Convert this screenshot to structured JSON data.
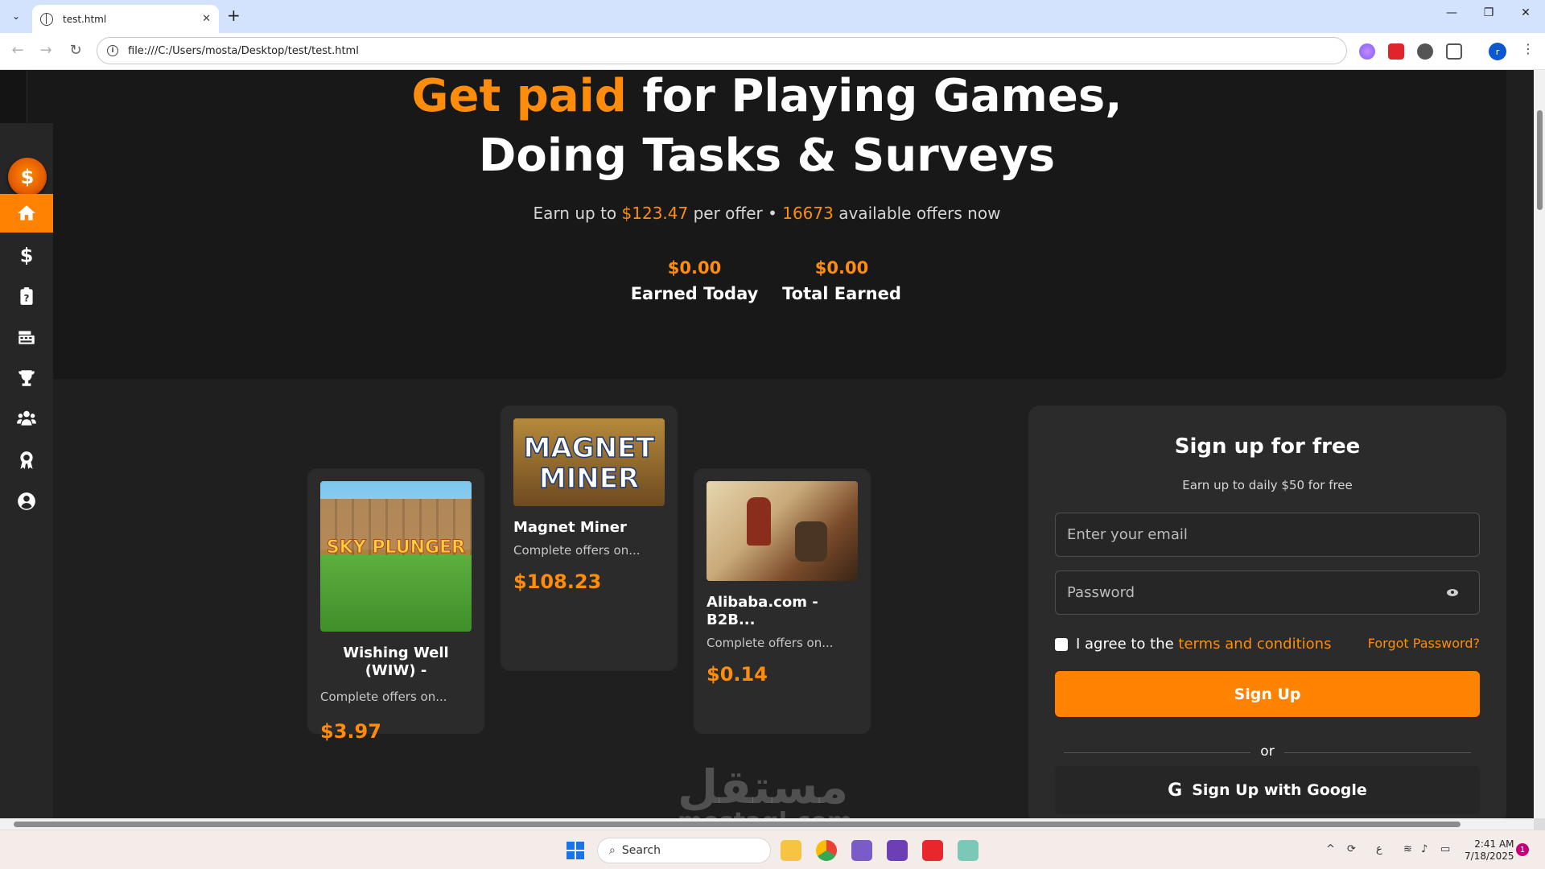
{
  "browser": {
    "tab_title": "test.html",
    "url": "file:///C:/Users/mosta/Desktop/test/test.html",
    "profile_initial": "r"
  },
  "sidebar": {
    "logo_symbol": "$",
    "items": [
      {
        "icon": "home-icon",
        "active": true
      },
      {
        "icon": "dollar-icon",
        "active": false
      },
      {
        "icon": "clipboard-question-icon",
        "active": false
      },
      {
        "icon": "keyboard-icon",
        "active": false
      },
      {
        "icon": "trophy-icon",
        "active": false
      },
      {
        "icon": "users-icon",
        "active": false
      },
      {
        "icon": "award-icon",
        "active": false
      },
      {
        "icon": "user-circle-icon",
        "active": false
      }
    ]
  },
  "hero": {
    "headline_accent": "Get paid",
    "headline_rest": " for Playing Games,",
    "headline_line2": "Doing Tasks & Surveys",
    "sub_prefix": "Earn up to ",
    "sub_amount": "$123.47",
    "sub_mid": " per offer • ",
    "sub_count": "16673",
    "sub_suffix": " available offers now",
    "stats": [
      {
        "value": "$0.00",
        "label": "Earned Today"
      },
      {
        "value": "$0.00",
        "label": "Total Earned"
      }
    ]
  },
  "offers": [
    {
      "title": "Wishing Well (WIW) -",
      "desc": "Complete offers on...",
      "price": "$3.97",
      "image_text": "SKY PLUNGER"
    },
    {
      "title": "Magnet Miner",
      "desc": "Complete offers on...",
      "price": "$108.23",
      "image_text_1": "MAGNET",
      "image_text_2": "MINER"
    },
    {
      "title": "Alibaba.com - B2B...",
      "desc": "Complete offers on...",
      "price": "$0.14"
    }
  ],
  "signup": {
    "title": "Sign up for free",
    "subtitle": "Earn up to daily $50 for free",
    "email_placeholder": "Enter your email",
    "password_placeholder": "Password",
    "agree_prefix": "I agree to the ",
    "agree_link": "terms and conditions",
    "forgot": "Forgot Password?",
    "button": "Sign Up",
    "or": "or",
    "google_button": "Sign Up with Google"
  },
  "watermark": {
    "ar": "مستقل",
    "en": "mostaql.com"
  },
  "taskbar": {
    "search_placeholder": "Search",
    "time": "2:41 AM",
    "date": "7/18/2025",
    "notifications": "1",
    "lang": "ع"
  },
  "colors": {
    "accent": "#ff8c0a",
    "active_nav": "#ff8200",
    "panel": "#2b2b2b"
  }
}
